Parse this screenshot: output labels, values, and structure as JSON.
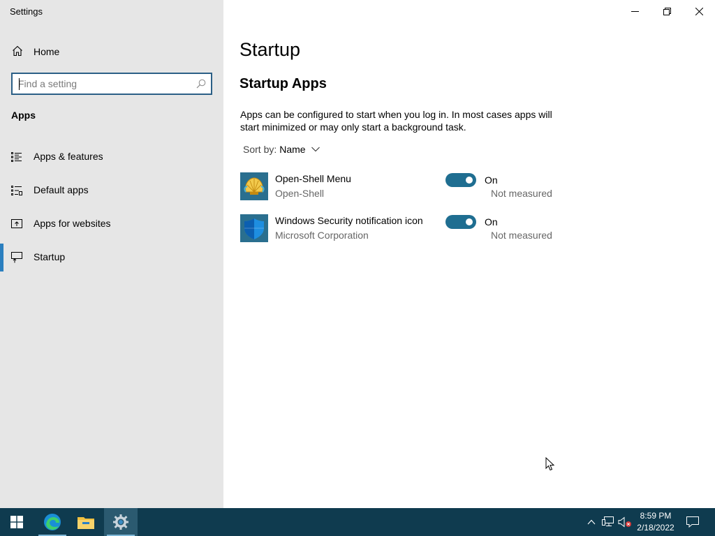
{
  "window": {
    "title": "Settings",
    "controls": [
      "minimize",
      "restore",
      "close"
    ]
  },
  "sidebar": {
    "home_label": "Home",
    "search_placeholder": "Find a setting",
    "section_title": "Apps",
    "items": [
      {
        "label": "Apps & features",
        "icon": "list-icon",
        "selected": false
      },
      {
        "label": "Default apps",
        "icon": "default-apps-icon",
        "selected": false
      },
      {
        "label": "Apps for websites",
        "icon": "web-apps-icon",
        "selected": false
      },
      {
        "label": "Startup",
        "icon": "startup-icon",
        "selected": true
      }
    ]
  },
  "main": {
    "page_title": "Startup",
    "sub_title": "Startup Apps",
    "description": "Apps can be configured to start when you log in. In most cases apps will start minimized or may only start a background task.",
    "sort_label": "Sort by:",
    "sort_value": "Name",
    "apps": [
      {
        "name": "Open-Shell Menu",
        "publisher": "Open-Shell",
        "state": "On",
        "enabled": true,
        "impact": "Not measured",
        "icon": "open-shell-icon"
      },
      {
        "name": "Windows Security notification icon",
        "publisher": "Microsoft Corporation",
        "state": "On",
        "enabled": true,
        "impact": "Not measured",
        "icon": "windows-security-icon"
      }
    ]
  },
  "taskbar": {
    "pinned": [
      "start-icon",
      "edge-icon",
      "file-explorer-icon",
      "settings-icon"
    ],
    "active": "settings-icon",
    "tray": [
      "show-hidden-icons-chevron",
      "network-icon",
      "volume-muted-icon"
    ],
    "time": "8:59 PM",
    "date": "2/18/2022"
  },
  "colors": {
    "sidebar_bg": "#e6e6e6",
    "accent": "#1f6e91",
    "taskbar_bg": "#0f3b4f",
    "selected_bar": "#2b7fbf"
  }
}
